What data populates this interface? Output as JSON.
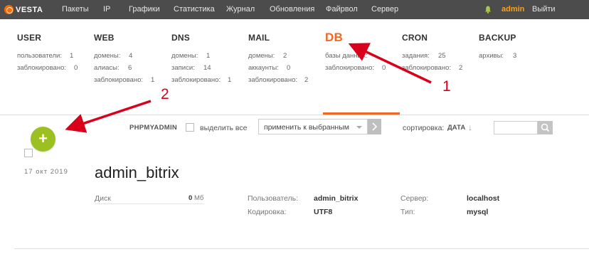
{
  "topbar": {
    "logo": "VESTA",
    "nav": [
      "Пакеты",
      "IP",
      "Графики",
      "Статистика",
      "Журнал",
      "Обновления",
      "Файрвол",
      "Сервер"
    ],
    "user": "admin",
    "logout": "Выйти"
  },
  "summary": {
    "user": {
      "title": "USER",
      "stats": [
        {
          "label": "пользователи:",
          "value": "1"
        },
        {
          "label": "заблокировано:",
          "value": "0"
        }
      ]
    },
    "web": {
      "title": "WEB",
      "stats": [
        {
          "label": "домены:",
          "value": "4"
        },
        {
          "label": "алиасы:",
          "value": "6"
        },
        {
          "label": "заблокировано:",
          "value": "1"
        }
      ]
    },
    "dns": {
      "title": "DNS",
      "stats": [
        {
          "label": "домены:",
          "value": "1"
        },
        {
          "label": "записи:",
          "value": "14"
        },
        {
          "label": "заблокировано:",
          "value": "1"
        }
      ]
    },
    "mail": {
      "title": "MAIL",
      "stats": [
        {
          "label": "домены:",
          "value": "2"
        },
        {
          "label": "аккаунты:",
          "value": "0"
        },
        {
          "label": "заблокировано:",
          "value": "2"
        }
      ]
    },
    "db": {
      "title": "DB",
      "stats": [
        {
          "label": "базы данных:",
          "value": ""
        },
        {
          "label": "заблокировано:",
          "value": "0"
        }
      ]
    },
    "cron": {
      "title": "CRON",
      "stats": [
        {
          "label": "задания:",
          "value": "25"
        },
        {
          "label": "заблокировано:",
          "value": "2"
        }
      ]
    },
    "backup": {
      "title": "BACKUP",
      "stats": [
        {
          "label": "архивы:",
          "value": "3"
        }
      ]
    }
  },
  "toolbar": {
    "phpmyadmin": "PHPMYADMIN",
    "select_all": "выделить все",
    "bulk_action": "применить к выбранным",
    "sort_label": "сортировка:",
    "sort_value": "ДАТА",
    "sort_arrow": "↓"
  },
  "record": {
    "date": "17  окт  2019",
    "name": "admin_bitrix",
    "disk_label": "Диск",
    "disk_value": "0",
    "disk_unit": "Мб",
    "user_label": "Пользователь:",
    "user_value": "admin_bitrix",
    "encoding_label": "Кодировка:",
    "encoding_value": "UTF8",
    "server_label": "Сервер:",
    "server_value": "localhost",
    "type_label": "Тип:",
    "type_value": "mysql"
  },
  "annotations": {
    "one": "1",
    "two": "2"
  },
  "colors": {
    "accent": "#f26722",
    "add_button": "#9cc021",
    "topbar": "#4c4c4c",
    "user": "#f6a11f",
    "annotation": "#d9001b"
  }
}
